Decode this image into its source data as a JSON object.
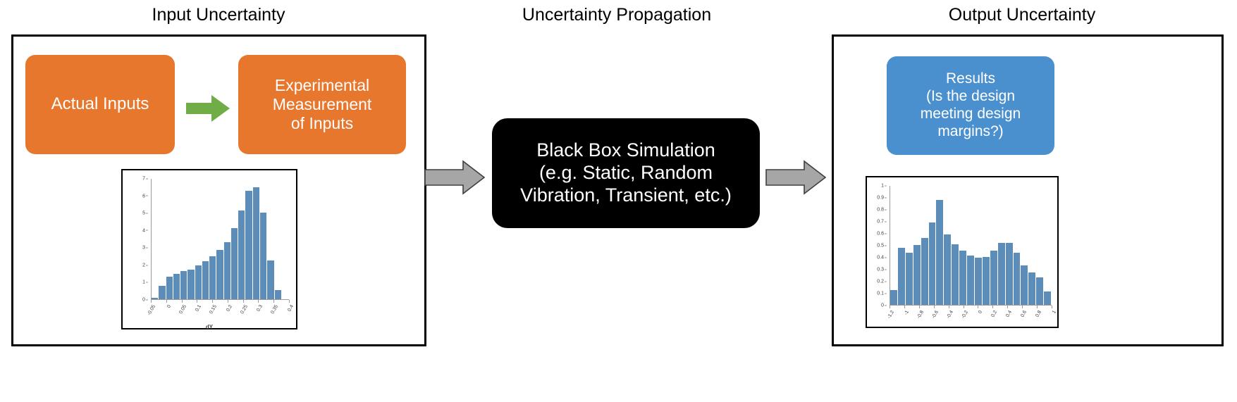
{
  "titles": {
    "input": "Input Uncertainty",
    "propagation": "Uncertainty Propagation",
    "output": "Output Uncertainty"
  },
  "boxes": {
    "actual_inputs": "Actual Inputs",
    "experimental_l1": "Experimental",
    "experimental_l2": "Measurement",
    "experimental_l3": "of Inputs",
    "blackbox_l1": "Black Box Simulation",
    "blackbox_l2": "(e.g. Static, Random",
    "blackbox_l3": "Vibration, Transient, etc.)",
    "results_l1": "Results",
    "results_l2": "(Is the design",
    "results_l3": "meeting design",
    "results_l4": "margins?)"
  },
  "colors": {
    "orange": "#E8772E",
    "blue": "#4A90CE",
    "black": "#000000",
    "green_arrow": "#70AD47",
    "grey_arrow": "#A6A6A6",
    "bar": "#5B8DB8"
  },
  "icons": {
    "green_arrow": "right-arrow-icon",
    "grey_arrow_1": "right-arrow-icon",
    "grey_arrow_2": "right-arrow-icon"
  },
  "chart_data": [
    {
      "id": "input-histogram",
      "type": "bar",
      "title": "",
      "xlabel": "dY",
      "ylabel": "",
      "ylim": [
        0,
        7
      ],
      "yticks": [
        0,
        1,
        2,
        3,
        4,
        5,
        6,
        7
      ],
      "xlim": [
        -0.05,
        0.4
      ],
      "xticks": [
        "-0.05",
        "0",
        "0.05",
        "0.1",
        "0.15",
        "0.2",
        "0.25",
        "0.3",
        "0.35",
        "0.4"
      ],
      "grid": false,
      "legend": "none",
      "values": [
        0.1,
        0.78,
        1.31,
        1.48,
        1.62,
        1.74,
        1.95,
        2.2,
        2.5,
        2.85,
        3.3,
        4.14,
        5.15,
        6.3,
        6.52,
        5.03,
        2.25,
        0.52,
        0.0
      ]
    },
    {
      "id": "output-histogram",
      "type": "bar",
      "title": "",
      "xlabel": "",
      "ylabel": "",
      "ylim": [
        0,
        1
      ],
      "yticks": [
        "0",
        "0.1",
        "0.2",
        "0.3",
        "0.4",
        "0.5",
        "0.6",
        "0.7",
        "0.8",
        "0.9",
        "1"
      ],
      "xlim": [
        -1.2,
        1.0
      ],
      "xticks": [
        "-1.2",
        "-1",
        "-0.8",
        "-0.6",
        "-0.4",
        "-0.2",
        "0",
        "0.2",
        "0.4",
        "0.6",
        "0.8",
        "1"
      ],
      "grid": false,
      "legend": "none",
      "values": [
        0.125,
        0.48,
        0.44,
        0.505,
        0.56,
        0.695,
        0.88,
        0.59,
        0.51,
        0.455,
        0.415,
        0.396,
        0.402,
        0.455,
        0.518,
        0.518,
        0.44,
        0.33,
        0.27,
        0.23,
        0.11
      ]
    }
  ]
}
